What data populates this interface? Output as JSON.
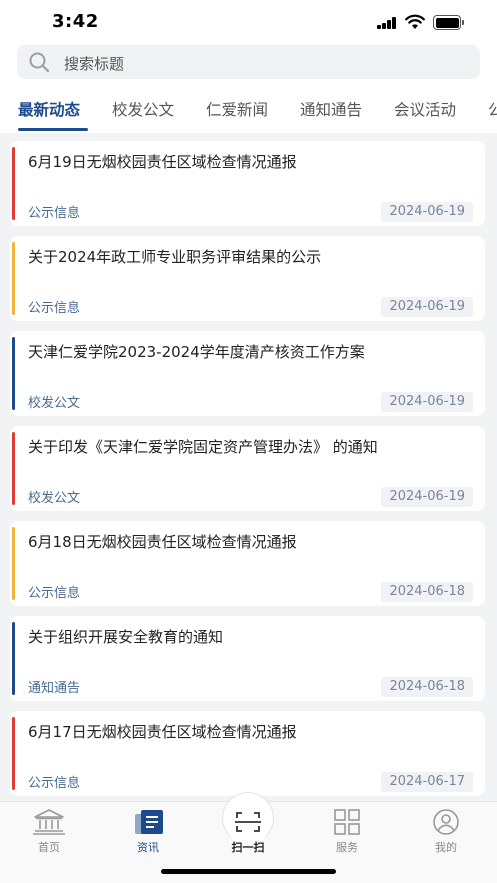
{
  "status_bar": {
    "time": "3:42"
  },
  "search": {
    "placeholder": "搜索标题"
  },
  "tabs": [
    {
      "label": "最新动态",
      "active": true
    },
    {
      "label": "校发公文",
      "active": false
    },
    {
      "label": "仁爱新闻",
      "active": false
    },
    {
      "label": "通知通告",
      "active": false
    },
    {
      "label": "会议活动",
      "active": false
    },
    {
      "label": "公示信息",
      "active": false
    }
  ],
  "news": [
    {
      "title": "6月19日无烟校园责任区域检查情况通报",
      "category": "公示信息",
      "date": "2024-06-19",
      "color": "#e03b36"
    },
    {
      "title": "关于2024年政工师专业职务评审结果的公示",
      "category": "公示信息",
      "date": "2024-06-19",
      "color": "#f2b33d"
    },
    {
      "title": "天津仁爱学院2023-2024学年度清产核资工作方案",
      "category": "校发公文",
      "date": "2024-06-19",
      "color": "#1c4a8c"
    },
    {
      "title": "关于印发《天津仁爱学院固定资产管理办法》 的通知",
      "category": "校发公文",
      "date": "2024-06-19",
      "color": "#e03b36"
    },
    {
      "title": "6月18日无烟校园责任区域检查情况通报",
      "category": "公示信息",
      "date": "2024-06-18",
      "color": "#f2b33d"
    },
    {
      "title": "关于组织开展安全教育的通知",
      "category": "通知通告",
      "date": "2024-06-18",
      "color": "#1c4a8c"
    },
    {
      "title": "6月17日无烟校园责任区域检查情况通报",
      "category": "公示信息",
      "date": "2024-06-17",
      "color": "#e03b36"
    }
  ],
  "bottom_nav": [
    {
      "label": "首页",
      "icon": "bank-icon"
    },
    {
      "label": "资讯",
      "icon": "news-icon",
      "active": true
    },
    {
      "label": "扫一扫",
      "icon": "scan-icon"
    },
    {
      "label": "服务",
      "icon": "grid-icon"
    },
    {
      "label": "我的",
      "icon": "user-icon"
    }
  ],
  "colors": {
    "accent": "#1c4a8c",
    "red": "#e03b36",
    "yellow": "#f2b33d"
  }
}
